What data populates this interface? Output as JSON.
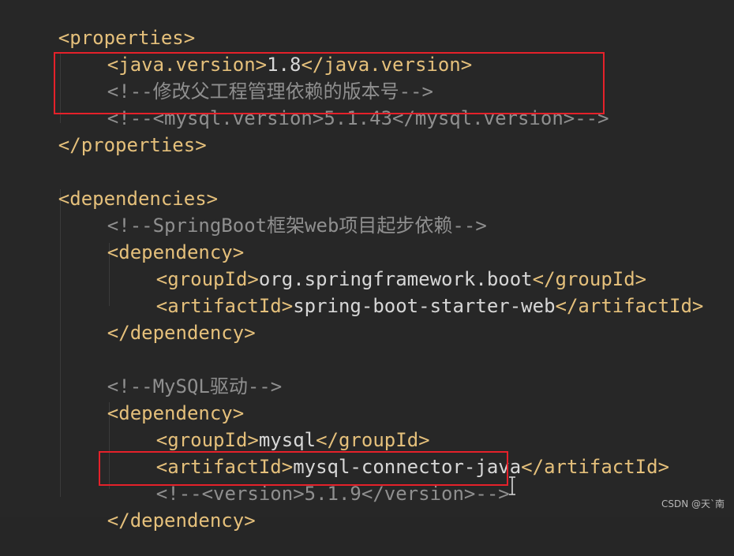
{
  "code": {
    "properties_open": "<properties>",
    "java_version_open": "<java.version>",
    "java_version_value": "1.8",
    "java_version_close": "</java.version>",
    "comment_parent_version": "<!--修改父工程管理依赖的版本号-->",
    "comment_mysql_version": "<!--<mysql.version>5.1.43</mysql.version>-->",
    "properties_close": "</properties>",
    "dependencies_open": "<dependencies>",
    "comment_springboot": "<!--SpringBoot框架web项目起步依赖-->",
    "dependency_open_1": "<dependency>",
    "groupId_open_1": "<groupId>",
    "groupId_value_1": "org.springframework.boot",
    "groupId_close_1": "</groupId>",
    "artifactId_open_1": "<artifactId>",
    "artifactId_value_1": "spring-boot-starter-web",
    "artifactId_close_1": "</artifactId>",
    "dependency_close_1": "</dependency>",
    "comment_mysql_driver": "<!--MySQL驱动-->",
    "dependency_open_2": "<dependency>",
    "groupId_open_2": "<groupId>",
    "groupId_value_2": "mysql",
    "groupId_close_2": "</groupId>",
    "artifactId_open_2": "<artifactId>",
    "artifactId_value_2": "mysql-connector-java",
    "artifactId_close_2": "</artifactId>",
    "comment_version": "<!--<version>5.1.9</version>-->",
    "dependency_close_2": "</dependency>"
  },
  "watermark": "CSDN @天`南",
  "colors": {
    "background": "#272727",
    "tag": "#e5c07b",
    "text": "#d7d7d7",
    "comment": "#8f8f8f",
    "highlight": "#e5212a"
  }
}
